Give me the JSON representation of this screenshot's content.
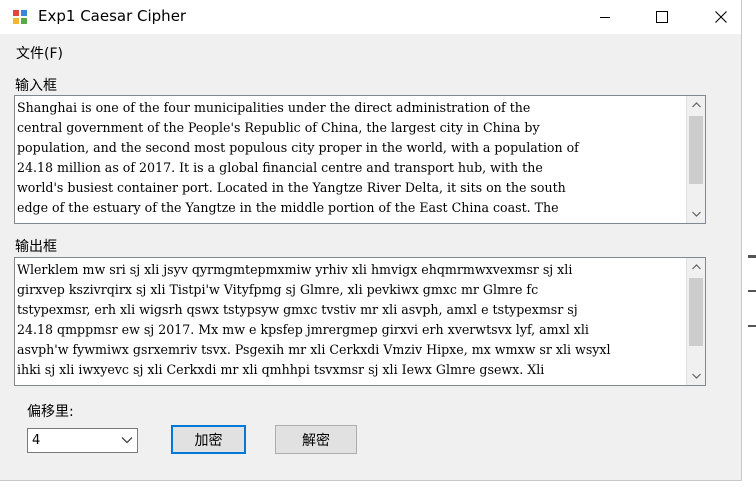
{
  "window": {
    "title": "Exp1 Caesar Cipher",
    "colors": {
      "titlebar": "#ffffff",
      "client": "#f0f0f0",
      "default_button_border": "#0078d7"
    }
  },
  "titlebar_controls": [
    "minimize-icon",
    "maximize-icon",
    "close-icon"
  ],
  "menu": {
    "file_label": "文件(F)"
  },
  "input": {
    "label": "输入框",
    "lines": [
      "Shanghai is one of the four municipalities under the direct administration of the",
      "central government of the People's Republic of China, the largest city in China by",
      "population, and the second most populous city proper in the world, with a population of",
      "24.18 million as of 2017. It is a global financial centre and transport hub, with the",
      "world's busiest container port. Located in the Yangtze River Delta, it sits on the south",
      "edge of the estuary of the Yangtze in the middle portion of the East China coast. The"
    ]
  },
  "output": {
    "label": "输出框",
    "lines": [
      "Wlerklem mw sri sj xli jsyv qyrmgmtepmxmiw yrhiv xli hmvigx ehqmrmwxvexmsr sj xli",
      "girxvep kszivrqirx sj xli Tistpi'w Vityfpmg sj Glmre, xli pevkiwx gmxc mr Glmre fc",
      "tstypexmsr, erh xli wigsrh qswx tstypsyw gmxc tvstiv mr xli asvph, amxl e tstypexmsr sj",
      "24.18 qmppmsr ew sj 2017. Mx mw e kpsfep jmrergmep girxvi erh xverwtsvx lyf, amxl xli",
      "asvph'w fywmiwx gsrxemriv tsvx. Psgexih mr xli Cerkxdi Vmziv Hipxe, mx wmxw sr xli wsyxl",
      "ihki sj xli iwxyevc sj xli Cerkxdi mr xli qmhhpi tsvxmsr sj xli Iewx Glmre gsewx. Xli"
    ]
  },
  "controls": {
    "shift_label": "偏移里:",
    "shift_value": "4",
    "encrypt_label": "加密",
    "decrypt_label": "解密"
  }
}
